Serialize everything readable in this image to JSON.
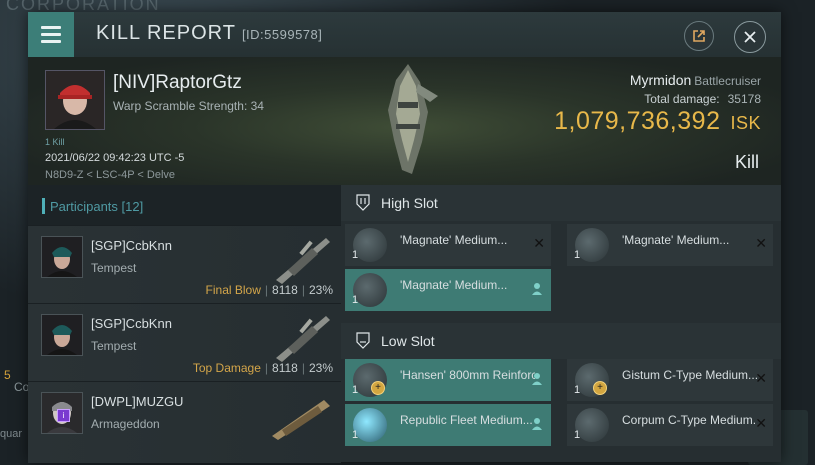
{
  "background": {
    "title": "CORPORATION",
    "side_num": "5",
    "side_co": "Co",
    "side_quar": "quar"
  },
  "window": {
    "title": "KILL REPORT",
    "id": "[ID:5599578]"
  },
  "victim": {
    "name": "[NIV]RaptorGtz",
    "warp_scramble": "Warp Scramble Strength: 34",
    "kill_count": "1 Kill",
    "timestamp": "2021/06/22 09:42:23 UTC -5",
    "location": "N8D9-Z < LSC-4P < Delve",
    "ship_name": "Myrmidon",
    "ship_class": "Battlecruiser",
    "total_damage_label": "Total damage:",
    "total_damage": "35178",
    "isk_value": "1,079,736,392",
    "isk_unit": "ISK",
    "result": "Kill"
  },
  "participants": {
    "header": "Participants [12]",
    "rows": [
      {
        "name": "[SGP]CcbKnn",
        "ship": "Tempest",
        "tag": "Final Blow",
        "damage": "8118",
        "percent": "23%"
      },
      {
        "name": "[SGP]CcbKnn",
        "ship": "Tempest",
        "tag": "Top Damage",
        "damage": "8118",
        "percent": "23%"
      },
      {
        "name": "[DWPL]MUZGU",
        "ship": "Armageddon",
        "badge": "i"
      }
    ]
  },
  "fitting": {
    "high_slot_label": "High Slot",
    "low_slot_label": "Low Slot",
    "high": [
      {
        "name": "'Magnate' Medium...",
        "qty": "1",
        "status": "destroyed"
      },
      {
        "name": "'Magnate' Medium...",
        "qty": "1",
        "status": "destroyed"
      },
      {
        "name": "'Magnate' Medium...",
        "qty": "1",
        "status": "dropped"
      }
    ],
    "low": [
      {
        "name": "'Hansen' 800mm Reinforce...",
        "qty": "1",
        "status": "dropped"
      },
      {
        "name": "Gistum C-Type Medium...",
        "qty": "1",
        "status": "destroyed"
      },
      {
        "name": "Republic Fleet Medium...",
        "qty": "1",
        "status": "dropped"
      },
      {
        "name": "Corpum C-Type Medium...",
        "qty": "1",
        "status": "destroyed"
      }
    ]
  },
  "colors": {
    "accent": "#3c7e78",
    "isk": "#e8b84a",
    "tag": "#d4a64a"
  }
}
